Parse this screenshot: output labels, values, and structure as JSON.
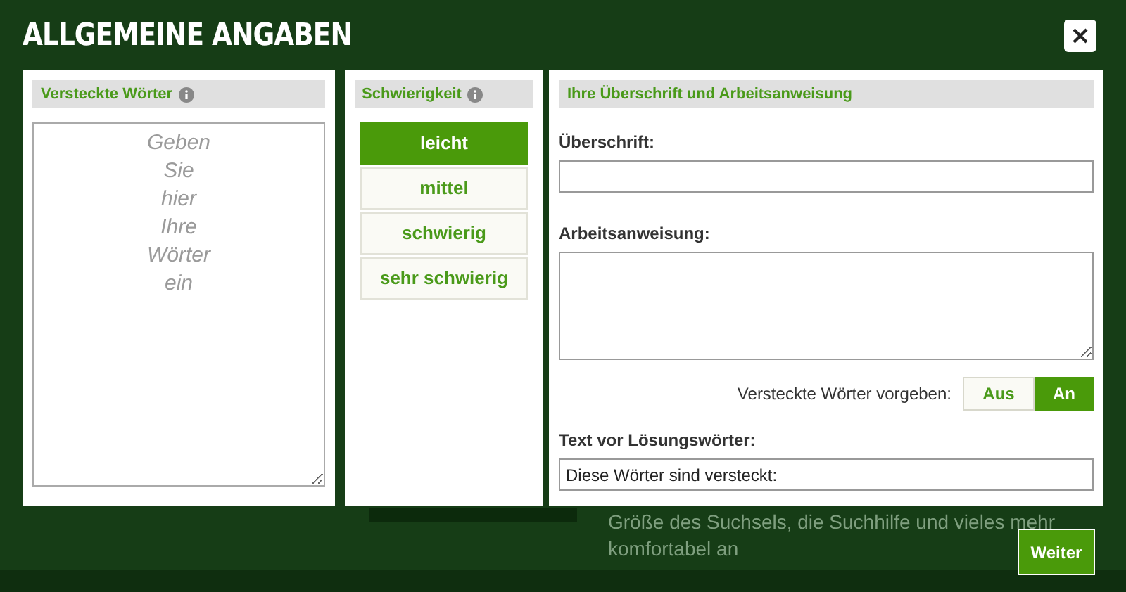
{
  "dialog": {
    "title": "ALLGEMEINE ANGABEN"
  },
  "words_panel": {
    "title": "Versteckte Wörter",
    "placeholder": "Geben\nSie\nhier\nIhre\nWörter\nein"
  },
  "difficulty_panel": {
    "title": "Schwierigkeit",
    "options": [
      {
        "label": "leicht",
        "selected": true
      },
      {
        "label": "mittel",
        "selected": false
      },
      {
        "label": "schwierig",
        "selected": false
      },
      {
        "label": "sehr schwierig",
        "selected": false
      }
    ]
  },
  "heading_panel": {
    "title": "Ihre Überschrift und Arbeitsanweisung",
    "heading_label": "Überschrift:",
    "instruction_label": "Arbeitsanweisung:",
    "toggle_label": "Versteckte Wörter vorgeben:",
    "toggle_options": [
      {
        "label": "Aus",
        "selected": false
      },
      {
        "label": "An",
        "selected": true
      }
    ],
    "solution_label": "Text vor Lösungswörter:",
    "solution_value": "Diese Wörter sind versteckt:"
  },
  "background": {
    "text_lines": [
      "Größe des Suchsels, die Suchhilfe und vieles mehr",
      "komfortabel an"
    ]
  },
  "next_button": "Weiter"
}
